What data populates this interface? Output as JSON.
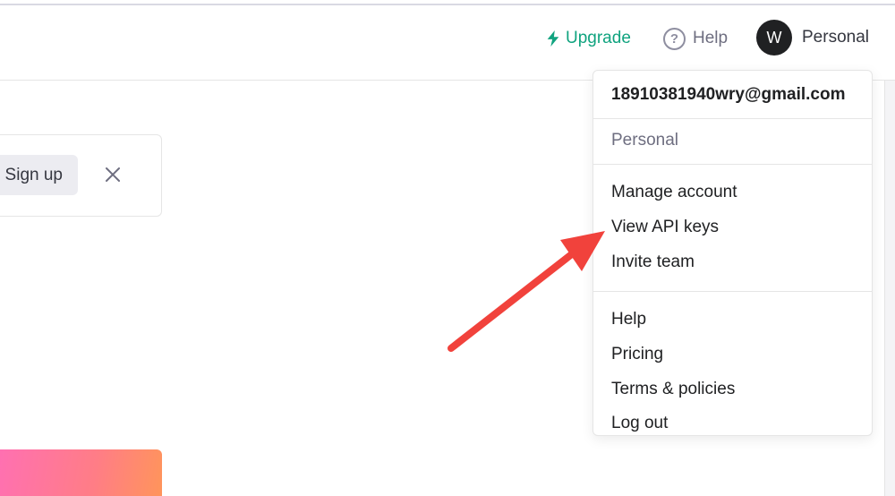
{
  "header": {
    "upgrade_label": "Upgrade",
    "help_label": "Help",
    "help_icon_glyph": "?",
    "avatar_initial": "W",
    "account_label": "Personal"
  },
  "banner": {
    "signup_label": "Sign up"
  },
  "dropdown": {
    "email": "18910381940wry@gmail.com",
    "organization": "Personal",
    "group1": [
      "Manage account",
      "View API keys",
      "Invite team"
    ],
    "group2": [
      "Help",
      "Pricing",
      "Terms & policies",
      "Log out"
    ]
  },
  "colors": {
    "accent": "#10a37f",
    "annotation_arrow": "#f1423c",
    "avatar_bg": "#202123"
  },
  "icons": {
    "upgrade": "lightning-bolt-icon",
    "help": "question-circle-icon",
    "close": "close-icon"
  }
}
